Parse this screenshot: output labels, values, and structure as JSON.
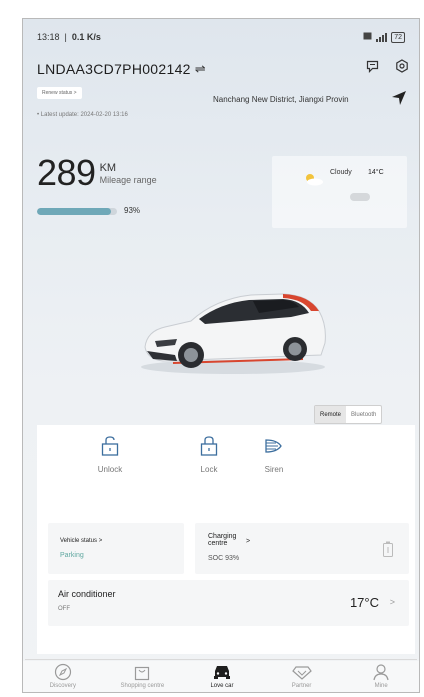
{
  "status_bar": {
    "time": "13:18",
    "net_speed": "0.1 K/s",
    "battery": "72"
  },
  "header": {
    "vin": "LNDAA3CD7PH002142",
    "switch_glyph": "⇌",
    "message_icon": "message-icon",
    "settings_icon": "settings-icon"
  },
  "renew_button": "Renew status >",
  "location": "Nanchang New District, Jiangxi Provin",
  "latest_update": "• Latest update: 2024-02-20 13:16",
  "range": {
    "value": "289",
    "unit": "KM",
    "label": "Mileage range",
    "soc_percent": "93%",
    "soc_fraction": 0.93
  },
  "weather": {
    "condition": "Cloudy",
    "temperature": "14°C"
  },
  "mode_toggle": {
    "remote": "Remote",
    "bluetooth": "Bluetooth"
  },
  "controls": [
    {
      "label": "Unlock",
      "icon": "unlock-icon"
    },
    {
      "label": "Lock",
      "icon": "lock-icon"
    },
    {
      "label": "Siren",
      "icon": "siren-icon"
    }
  ],
  "vehicle_status": {
    "title": "Vehicle status >",
    "value": "Parking"
  },
  "charging": {
    "title_line1": "Charging",
    "title_line2": "centre",
    "arrow": ">",
    "value": "SOC 93%"
  },
  "air_conditioner": {
    "title": "Air conditioner",
    "state": "OFF",
    "temperature": "17°C",
    "arrow": ">"
  },
  "tabs": [
    {
      "label": "Discovery",
      "icon": "compass-icon",
      "active": false
    },
    {
      "label": "Shopping centre",
      "icon": "shopping-bag-icon",
      "active": false
    },
    {
      "label": "Love car",
      "icon": "car-icon",
      "active": true
    },
    {
      "label": "Partner",
      "icon": "diamond-icon",
      "active": false
    },
    {
      "label": "Mine",
      "icon": "person-icon",
      "active": false
    }
  ],
  "colors": {
    "accent_teal": "#6fa8b8",
    "parking_green": "#5fa7a0",
    "car_white": "#f4f5f6",
    "car_red": "#d8462f"
  }
}
